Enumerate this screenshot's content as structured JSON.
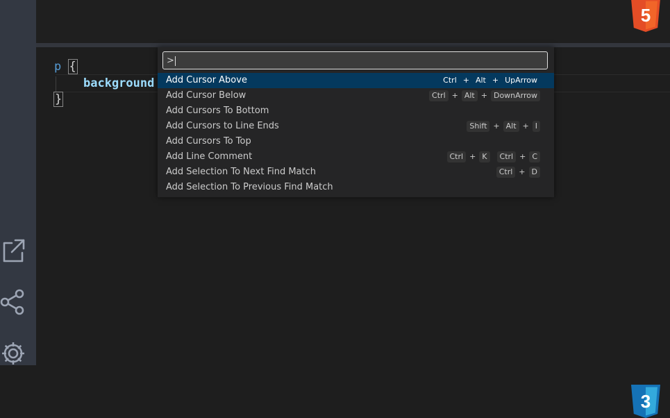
{
  "editor": {
    "code_line1_selector": "p",
    "code_open_brace": "{",
    "code_line2_property": "background",
    "code_close_brace": "}"
  },
  "palette": {
    "input_value": ">",
    "items": [
      {
        "label": "Add Cursor Above",
        "keys": [
          [
            "Ctrl",
            "Alt",
            "UpArrow"
          ]
        ]
      },
      {
        "label": "Add Cursor Below",
        "keys": [
          [
            "Ctrl",
            "Alt",
            "DownArrow"
          ]
        ]
      },
      {
        "label": "Add Cursors To Bottom",
        "keys": []
      },
      {
        "label": "Add Cursors to Line Ends",
        "keys": [
          [
            "Shift",
            "Alt",
            "I"
          ]
        ]
      },
      {
        "label": "Add Cursors To Top",
        "keys": []
      },
      {
        "label": "Add Line Comment",
        "keys": [
          [
            "Ctrl",
            "K"
          ],
          [
            "Ctrl",
            "C"
          ]
        ]
      },
      {
        "label": "Add Selection To Next Find Match",
        "keys": [
          [
            "Ctrl",
            "D"
          ]
        ]
      },
      {
        "label": "Add Selection To Previous Find Match",
        "keys": []
      }
    ],
    "selected_index": 0
  },
  "badges": {
    "html": "5",
    "css": "3"
  },
  "icons": [
    "open-external-icon",
    "share-icon",
    "gear-icon",
    "html5-icon",
    "css3-icon"
  ],
  "colors": {
    "selection": "#04395e",
    "html5": "#e44d26",
    "css3": "#1572b6",
    "activity_bar": "#333842"
  }
}
